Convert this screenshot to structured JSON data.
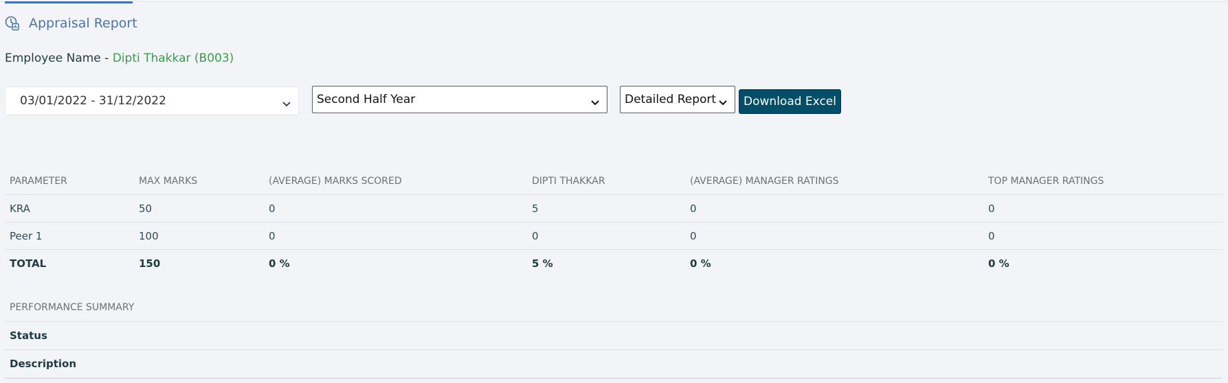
{
  "header": {
    "title": "Appraisal Report",
    "icon": "clock-report-icon"
  },
  "employee": {
    "label": "Employee Name",
    "separator": " - ",
    "name": "Dipti Thakkar (B003)"
  },
  "filters": {
    "date_range": "03/01/2022 - 31/12/2022",
    "period": "Second Half Year",
    "report_type": "Detailed Report",
    "download_label": "Download Excel"
  },
  "table": {
    "columns": [
      "PARAMETER",
      "MAX MARKS",
      "(AVERAGE) MARKS SCORED",
      "DIPTI THAKKAR",
      "(AVERAGE) MANAGER RATINGS",
      "TOP MANAGER RATINGS"
    ],
    "rows": [
      [
        "KRA",
        "50",
        "0",
        "5",
        "0",
        "0"
      ],
      [
        "Peer 1",
        "100",
        "0",
        "0",
        "0",
        "0"
      ]
    ],
    "total": [
      "TOTAL",
      "150",
      "0 %",
      "5 %",
      "0 %",
      "0 %"
    ]
  },
  "summary": {
    "heading": "PERFORMANCE SUMMARY",
    "rows": [
      "Status",
      "Description"
    ]
  },
  "colors": {
    "accent": "#3d6fb6",
    "button": "#024d68",
    "name_green": "#3a9e4c"
  }
}
